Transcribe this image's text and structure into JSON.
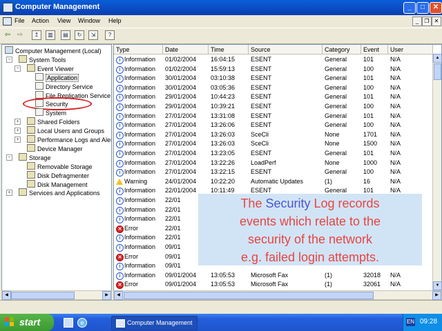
{
  "window": {
    "title": "Computer Management"
  },
  "menu": [
    "File",
    "Action",
    "View",
    "Window",
    "Help"
  ],
  "tree": [
    {
      "label": "Computer Management (Local)",
      "level": 0,
      "icon": "computer"
    },
    {
      "label": "System Tools",
      "level": 1,
      "icon": "tools"
    },
    {
      "label": "Event Viewer",
      "level": 2,
      "icon": "event-viewer"
    },
    {
      "label": "Application",
      "level": 3,
      "icon": "log",
      "selected": true
    },
    {
      "label": "Directory Service",
      "level": 3,
      "icon": "log"
    },
    {
      "label": "File Replication Service",
      "level": 3,
      "icon": "log"
    },
    {
      "label": "Security",
      "level": 3,
      "icon": "log",
      "circled": true
    },
    {
      "label": "System",
      "level": 3,
      "icon": "log"
    },
    {
      "label": "Shared Folders",
      "level": 2,
      "icon": "folder"
    },
    {
      "label": "Local Users and Groups",
      "level": 2,
      "icon": "users"
    },
    {
      "label": "Performance Logs and Alerts",
      "level": 2,
      "icon": "perf"
    },
    {
      "label": "Device Manager",
      "level": 2,
      "icon": "device"
    },
    {
      "label": "Storage",
      "level": 1,
      "icon": "storage"
    },
    {
      "label": "Removable Storage",
      "level": 2,
      "icon": "removable"
    },
    {
      "label": "Disk Defragmenter",
      "level": 2,
      "icon": "defrag"
    },
    {
      "label": "Disk Management",
      "level": 2,
      "icon": "disk"
    },
    {
      "label": "Services and Applications",
      "level": 1,
      "icon": "services"
    }
  ],
  "columns": [
    "Type",
    "Date",
    "Time",
    "Source",
    "Category",
    "Event",
    "User"
  ],
  "events": [
    {
      "type": "Information",
      "date": "01/02/2004",
      "time": "16:04:15",
      "source": "ESENT",
      "category": "General",
      "event": "101",
      "user": "N/A"
    },
    {
      "type": "Information",
      "date": "01/02/2004",
      "time": "15:59:13",
      "source": "ESENT",
      "category": "General",
      "event": "100",
      "user": "N/A"
    },
    {
      "type": "Information",
      "date": "30/01/2004",
      "time": "03:10:38",
      "source": "ESENT",
      "category": "General",
      "event": "101",
      "user": "N/A"
    },
    {
      "type": "Information",
      "date": "30/01/2004",
      "time": "03:05:36",
      "source": "ESENT",
      "category": "General",
      "event": "100",
      "user": "N/A"
    },
    {
      "type": "Information",
      "date": "29/01/2004",
      "time": "10:44:23",
      "source": "ESENT",
      "category": "General",
      "event": "101",
      "user": "N/A"
    },
    {
      "type": "Information",
      "date": "29/01/2004",
      "time": "10:39:21",
      "source": "ESENT",
      "category": "General",
      "event": "100",
      "user": "N/A"
    },
    {
      "type": "Information",
      "date": "27/01/2004",
      "time": "13:31:08",
      "source": "ESENT",
      "category": "General",
      "event": "101",
      "user": "N/A"
    },
    {
      "type": "Information",
      "date": "27/01/2004",
      "time": "13:26:06",
      "source": "ESENT",
      "category": "General",
      "event": "100",
      "user": "N/A"
    },
    {
      "type": "Information",
      "date": "27/01/2004",
      "time": "13:26:03",
      "source": "SceCli",
      "category": "None",
      "event": "1701",
      "user": "N/A"
    },
    {
      "type": "Information",
      "date": "27/01/2004",
      "time": "13:26:03",
      "source": "SceCli",
      "category": "None",
      "event": "1500",
      "user": "N/A"
    },
    {
      "type": "Information",
      "date": "27/01/2004",
      "time": "13:23:05",
      "source": "ESENT",
      "category": "General",
      "event": "101",
      "user": "N/A"
    },
    {
      "type": "Information",
      "date": "27/01/2004",
      "time": "13:22:26",
      "source": "LoadPerf",
      "category": "None",
      "event": "1000",
      "user": "N/A"
    },
    {
      "type": "Information",
      "date": "27/01/2004",
      "time": "13:22:15",
      "source": "ESENT",
      "category": "General",
      "event": "100",
      "user": "N/A"
    },
    {
      "type": "Warning",
      "date": "24/01/2004",
      "time": "10:22:20",
      "source": "Automatic Updates",
      "category": "(1)",
      "event": "16",
      "user": "N/A"
    },
    {
      "type": "Information",
      "date": "22/01/2004",
      "time": "10:11:49",
      "source": "ESENT",
      "category": "General",
      "event": "101",
      "user": "N/A"
    },
    {
      "type": "Information",
      "date": "22/01",
      "time": "",
      "source": "",
      "category": "",
      "event": "",
      "user": ""
    },
    {
      "type": "Information",
      "date": "22/01",
      "time": "",
      "source": "",
      "category": "",
      "event": "",
      "user": ""
    },
    {
      "type": "Information",
      "date": "22/01",
      "time": "",
      "source": "",
      "category": "",
      "event": "",
      "user": ""
    },
    {
      "type": "Error",
      "date": "22/01",
      "time": "",
      "source": "",
      "category": "",
      "event": "",
      "user": ""
    },
    {
      "type": "Information",
      "date": "22/01",
      "time": "",
      "source": "",
      "category": "",
      "event": "",
      "user": ""
    },
    {
      "type": "Information",
      "date": "09/01",
      "time": "",
      "source": "",
      "category": "",
      "event": "",
      "user": ""
    },
    {
      "type": "Error",
      "date": "09/01",
      "time": "",
      "source": "",
      "category": "",
      "event": "",
      "user": ""
    },
    {
      "type": "Information",
      "date": "09/01",
      "time": "",
      "source": "",
      "category": "",
      "event": "",
      "user": ""
    },
    {
      "type": "Information",
      "date": "09/01/2004",
      "time": "13:05:53",
      "source": "Microsoft Fax",
      "category": "(1)",
      "event": "32018",
      "user": "N/A"
    },
    {
      "type": "Error",
      "date": "09/01/2004",
      "time": "13:05:53",
      "source": "Microsoft Fax",
      "category": "(1)",
      "event": "32061",
      "user": "N/A"
    }
  ],
  "overlay": {
    "l1a": "The ",
    "l1b": "Security",
    "l1c": " Log records",
    "l2": "events which relate to the",
    "l3": "security of the network",
    "l4": "e.g. failed login attempts."
  },
  "taskbar": {
    "start": "start",
    "task": "Computer Management",
    "lang": "EN",
    "clock": "09:28"
  },
  "colors": {
    "accent": "#0a5fd8",
    "overlay_text": "#e74545",
    "overlay_highlight": "#4d55d0",
    "circle": "#d81c1c"
  }
}
